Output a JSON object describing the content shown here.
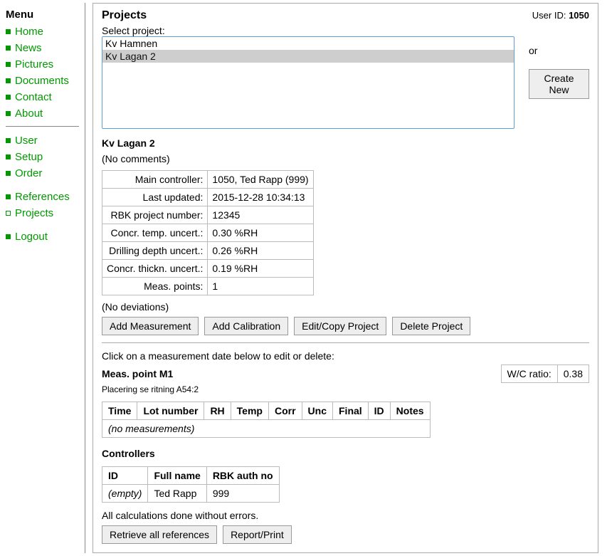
{
  "sidebar": {
    "title": "Menu",
    "groups": [
      [
        "Home",
        "News",
        "Pictures",
        "Documents",
        "Contact",
        "About"
      ],
      [
        "User",
        "Setup",
        "Order"
      ],
      [
        "References",
        "Projects"
      ],
      [
        "Logout"
      ]
    ],
    "active": "Projects"
  },
  "header": {
    "title": "Projects",
    "user_id_label": "User ID:",
    "user_id": "1050"
  },
  "select": {
    "label": "Select project:",
    "options": [
      "Kv Hamnen",
      "Kv Lagan 2"
    ],
    "selected": "Kv Lagan 2",
    "or_label": "or",
    "create_new": "Create New"
  },
  "project": {
    "name": "Kv Lagan 2",
    "comments": "(No comments)",
    "details": [
      {
        "label": "Main controller:",
        "value": "1050, Ted Rapp (999)"
      },
      {
        "label": "Last updated:",
        "value": "2015-12-28 10:34:13"
      },
      {
        "label": "RBK project number:",
        "value": "12345"
      },
      {
        "label": "Concr. temp. uncert.:",
        "value": "0.30 %RH"
      },
      {
        "label": "Drilling depth uncert.:",
        "value": "0.26 %RH"
      },
      {
        "label": "Concr. thickn. uncert.:",
        "value": "0.19 %RH"
      },
      {
        "label": "Meas. points:",
        "value": "1"
      }
    ],
    "deviations": "(No deviations)"
  },
  "buttons": {
    "add_measurement": "Add Measurement",
    "add_calibration": "Add Calibration",
    "edit_copy": "Edit/Copy Project",
    "delete_project": "Delete Project",
    "retrieve_refs": "Retrieve all references",
    "report_print": "Report/Print"
  },
  "instructions": {
    "click_date": "Click on a measurement date below to edit or delete:"
  },
  "meas_point": {
    "title": "Meas. point M1",
    "subtitle": "Placering se ritning A54:2",
    "wc_label": "W/C ratio:",
    "wc_value": "0.38",
    "columns": [
      "Time",
      "Lot number",
      "RH",
      "Temp",
      "Corr",
      "Unc",
      "Final",
      "ID",
      "Notes"
    ],
    "no_measurements": "(no measurements)"
  },
  "controllers": {
    "title": "Controllers",
    "columns": [
      "ID",
      "Full name",
      "RBK auth no"
    ],
    "rows": [
      {
        "id": "(empty)",
        "name": "Ted Rapp",
        "auth": "999"
      }
    ]
  },
  "calc_message": "All calculations done without errors."
}
